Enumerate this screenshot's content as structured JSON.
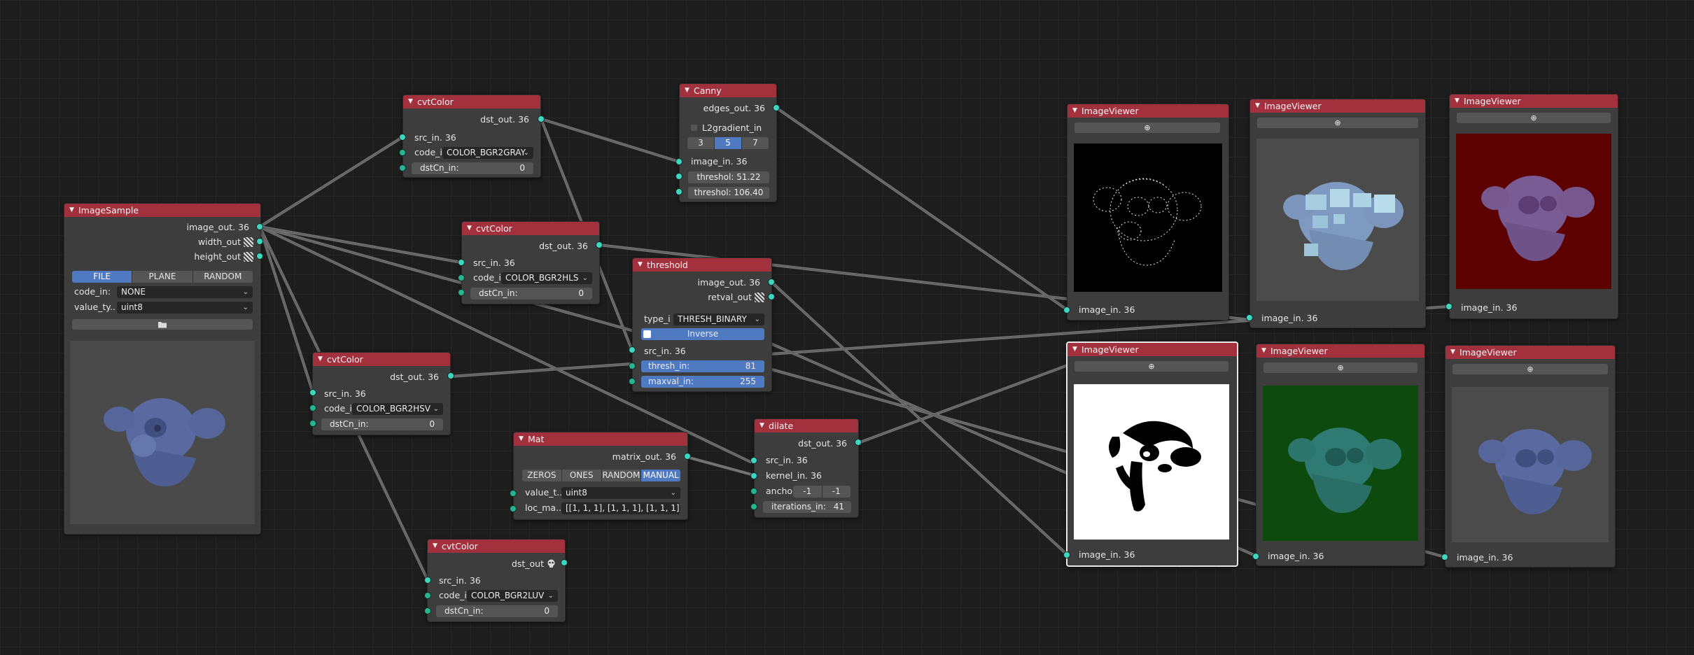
{
  "colors": {
    "header": "#a2313d",
    "node_bg": "#3d3d3d",
    "socket": "#3fd6bf",
    "socket_dark": "#0e3f38",
    "wire": "#8a8a8a",
    "accent": "#4f79c0"
  },
  "image_sample": {
    "title": "ImageSample",
    "outputs": [
      "image_out. 36",
      "width_out",
      "height_out"
    ],
    "modes": [
      {
        "label": "FILE",
        "active": true
      },
      {
        "label": "PLANE",
        "active": false
      },
      {
        "label": "RANDOM",
        "active": false
      }
    ],
    "code_label": "code_in:",
    "code_value": "NONE",
    "value_label": "value_ty..",
    "value_value": "uint8",
    "file_icon": "folder-icon"
  },
  "cvt_gray": {
    "title": "cvtColor",
    "output": "dst_out. 36",
    "src": "src_in. 36",
    "code_label": "code_i",
    "code_value": "COLOR_BGR2GRAY",
    "dst_label": "dstCn_in:",
    "dst_value": "0"
  },
  "cvt_hls": {
    "title": "cvtColor",
    "output": "dst_out. 36",
    "src": "src_in. 36",
    "code_label": "code_i",
    "code_value": "COLOR_BGR2HLS",
    "dst_label": "dstCn_in:",
    "dst_value": "0"
  },
  "cvt_hsv": {
    "title": "cvtColor",
    "output": "dst_out. 36",
    "src": "src_in. 36",
    "code_label": "code_i",
    "code_value": "COLOR_BGR2HSV",
    "dst_label": "dstCn_in:",
    "dst_value": "0"
  },
  "cvt_luv": {
    "title": "cvtColor",
    "output": "dst_out",
    "src": "src_in. 36",
    "code_label": "code_i",
    "code_value": "COLOR_BGR2LUV",
    "dst_label": "dstCn_in:",
    "dst_value": "0"
  },
  "canny": {
    "title": "Canny",
    "output": "edges_out. 36",
    "l2_label": "L2gradient_in",
    "apertures": [
      {
        "label": "3",
        "active": false
      },
      {
        "label": "5",
        "active": true
      },
      {
        "label": "7",
        "active": false
      }
    ],
    "image_in": "image_in. 36",
    "threshold1": "threshol: 51.22",
    "threshold2": "threshol: 106.40"
  },
  "threshold": {
    "title": "threshold",
    "outputs": [
      "image_out. 36",
      "retval_out"
    ],
    "type_label": "type_i",
    "type_value": "THRESH_BINARY",
    "inverse_label": "Inverse",
    "src": "src_in. 36",
    "thresh_label": "thresh_in:",
    "thresh_value": "81",
    "maxval_label": "maxval_in:",
    "maxval_value": "255"
  },
  "mat": {
    "title": "Mat",
    "output": "matrix_out. 36",
    "modes": [
      {
        "label": "ZEROS",
        "active": false
      },
      {
        "label": "ONES",
        "active": false
      },
      {
        "label": "RANDOM",
        "active": false
      },
      {
        "label": "MANUAL",
        "active": true
      }
    ],
    "value_label": "value_t..",
    "value_value": "uint8",
    "loc_label": "loc_ma..",
    "loc_value": "[[1, 1, 1], [1, 1, 1], [1, 1, 1]]"
  },
  "dilate": {
    "title": "dilate",
    "output": "dst_out. 36",
    "src": "src_in. 36",
    "kernel": "kernel_in. 36",
    "anchor_label": "ancho",
    "anchor_x": "-1",
    "anchor_y": "-1",
    "iterations_label": "iterations_in:",
    "iterations_value": "41"
  },
  "viewers": [
    {
      "title": "ImageViewer",
      "input": "image_in. 36",
      "content": "edges"
    },
    {
      "title": "ImageViewer",
      "input": "image_in. 36",
      "content": "hls"
    },
    {
      "title": "ImageViewer",
      "input": "image_in. 36",
      "content": "red"
    },
    {
      "title": "ImageViewer",
      "input": "image_in. 36",
      "content": "binary"
    },
    {
      "title": "ImageViewer",
      "input": "image_in. 36",
      "content": "green"
    },
    {
      "title": "ImageViewer",
      "input": "image_in. 36",
      "content": "original"
    }
  ]
}
